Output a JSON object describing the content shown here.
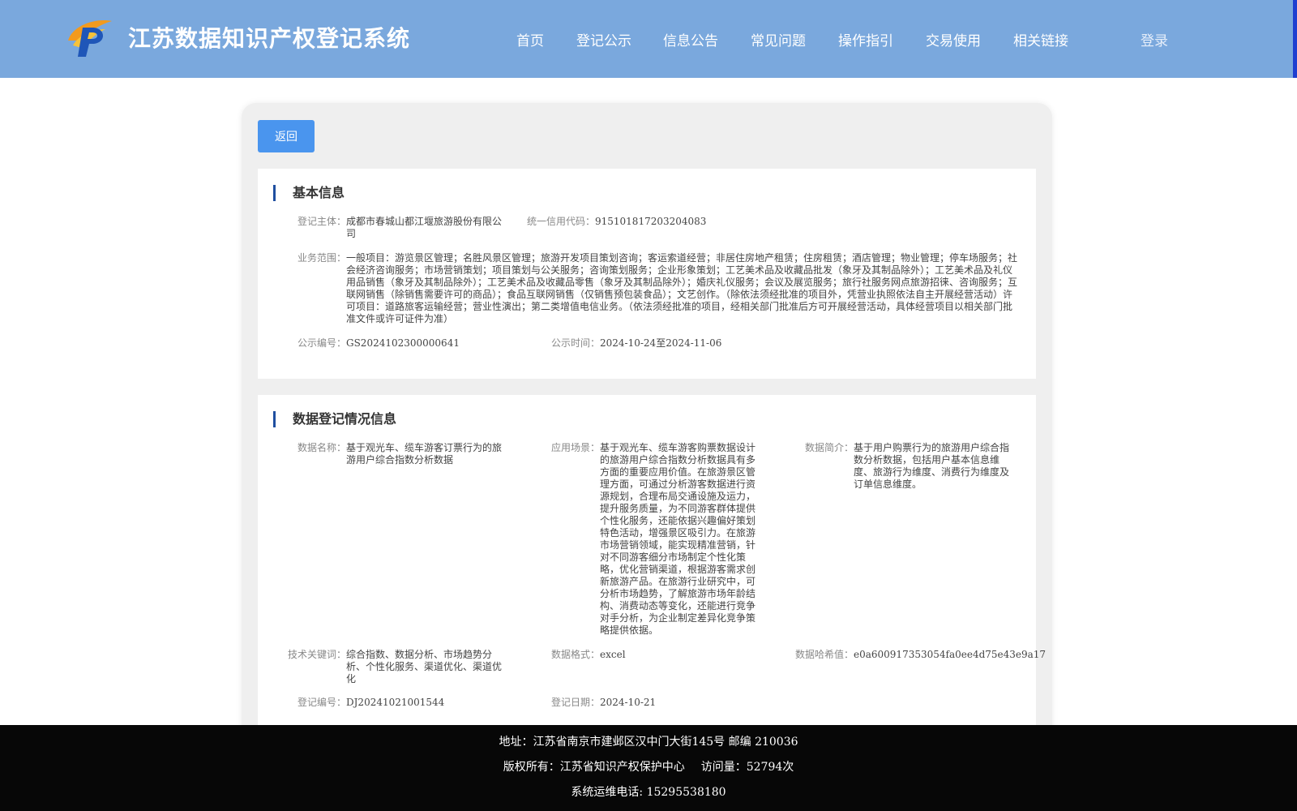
{
  "header": {
    "site_title": "江苏数据知识产权登记系统",
    "nav": [
      "首页",
      "登记公示",
      "信息公告",
      "常见问题",
      "操作指引",
      "交易使用",
      "相关链接"
    ],
    "login": "登录"
  },
  "toolbar": {
    "back_label": "返回"
  },
  "basic_info": {
    "heading": "基本信息",
    "subject_label": "登记主体：",
    "subject_value": "成都市春城山都江堰旅游股份有限公司",
    "credit_code_label": "统一信用代码：",
    "credit_code_value": "915101817203204083",
    "scope_label": "业务范围：",
    "scope_value": "一般项目：游览景区管理；名胜风景区管理；旅游开发项目策划咨询；客运索道经营；非居住房地产租赁；住房租赁；酒店管理；物业管理；停车场服务；社会经济咨询服务；市场营销策划；项目策划与公关服务；咨询策划服务；企业形象策划；工艺美术品及收藏品批发（象牙及其制品除外）；工艺美术品及礼仪用品销售（象牙及其制品除外）；工艺美术品及收藏品零售（象牙及其制品除外）；婚庆礼仪服务；会议及展览服务；旅行社服务网点旅游招徕、咨询服务；互联网销售（除销售需要许可的商品）；食品互联网销售（仅销售预包装食品）；文艺创作。（除依法须经批准的项目外，凭营业执照依法自主开展经营活动）许可项目：道路旅客运输经营；营业性演出；第二类增值电信业务。（依法须经批准的项目，经相关部门批准后方可开展经营活动，具体经营项目以相关部门批准文件或许可证件为准）",
    "notice_no_label": "公示编号：",
    "notice_no_value": "GS2024102300000641",
    "notice_time_label": "公示时间：",
    "notice_time_value": "2024-10-24至2024-11-06"
  },
  "data_info": {
    "heading": "数据登记情况信息",
    "name_label": "数据名称：",
    "name_value": "基于观光车、缆车游客订票行为的旅游用户综合指数分析数据",
    "scene_label": "应用场景：",
    "scene_value": "基于观光车、缆车游客购票数据设计的旅游用户综合指数分析数据具有多方面的重要应用价值。在旅游景区管理方面，可通过分析游客数据进行资源规划，合理布局交通设施及运力，提升服务质量，为不同游客群体提供个性化服务，还能依据兴趣偏好策划特色活动，增强景区吸引力。在旅游市场营销领域，能实现精准营销，针对不同游客细分市场制定个性化策略，优化营销渠道，根据游客需求创新旅游产品。在旅游行业研究中，可分析市场趋势，了解旅游市场年龄结构、消费动态等变化，还能进行竞争对手分析，为企业制定差异化竞争策略提供依据。",
    "intro_label": "数据简介：",
    "intro_value": "基于用户购票行为的旅游用户综合指数分析数据，包括用户基本信息维度、旅游行为维度、消费行为维度及订单信息维度。",
    "keywords_label": "技术关键词：",
    "keywords_value": "综合指数、数据分析、市场趋势分析、个性化服务、渠道优化、渠道优化",
    "format_label": "数据格式：",
    "format_value": "excel",
    "hash_label": "数据哈希值：",
    "hash_value": "e0a600917353054fa0ee4d75e43e9a17",
    "reg_no_label": "登记编号：",
    "reg_no_value": "DJ20241021001544",
    "reg_date_label": "登记日期：",
    "reg_date_value": "2024-10-21"
  },
  "footer": {
    "address": "地址：江苏省南京市建邺区汉中门大街145号 邮编 210036",
    "copyright": "版权所有：江苏省知识产权保护中心",
    "visits": "访问量：52794次",
    "hotline": "系统运维电话: 15295538180"
  }
}
